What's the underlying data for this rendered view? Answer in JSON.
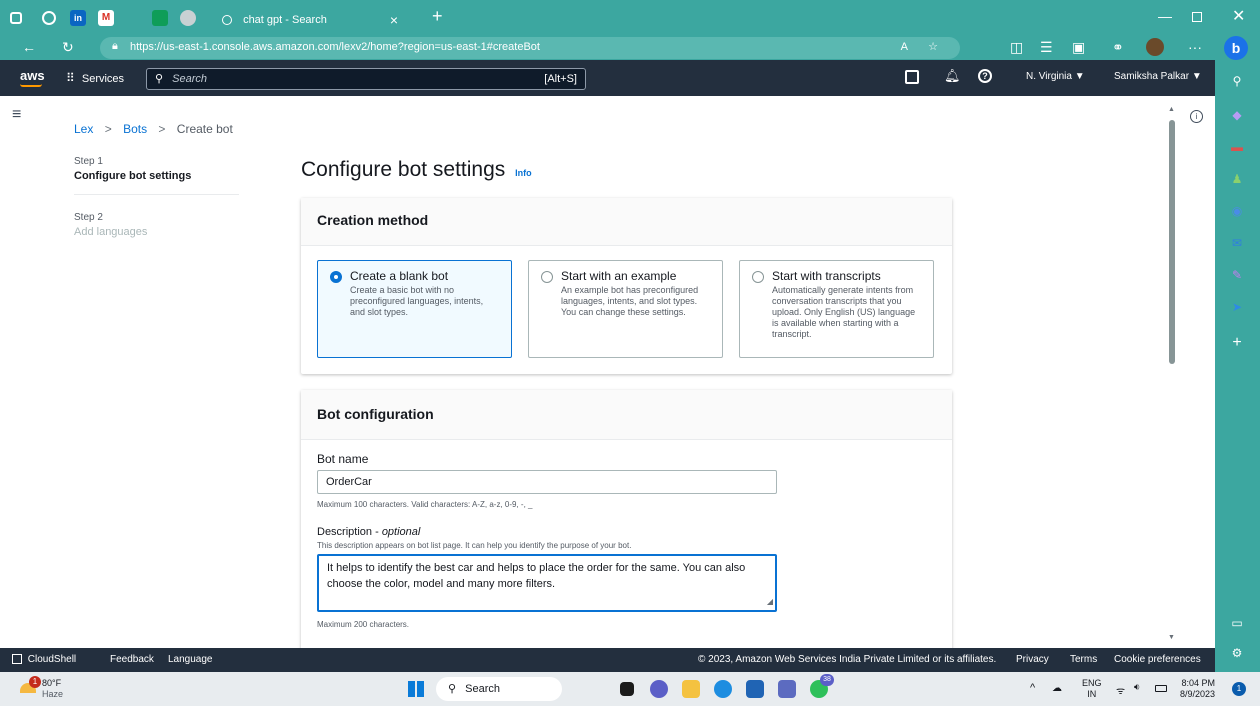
{
  "browser": {
    "tab_title": "chat gpt - Search",
    "url": "https://us-east-1.console.aws.amazon.com/lexv2/home?region=us-east-1#createBot"
  },
  "aws_header": {
    "logo": "aws",
    "services": "Services",
    "search_placeholder": "Search",
    "search_shortcut": "[Alt+S]",
    "region": "N. Virginia",
    "user": "Samiksha Palkar"
  },
  "breadcrumb": [
    "Lex",
    "Bots",
    "Create bot"
  ],
  "steps": [
    {
      "step": "Step 1",
      "label": "Configure bot settings",
      "active": true
    },
    {
      "step": "Step 2",
      "label": "Add languages",
      "active": false
    }
  ],
  "page": {
    "title": "Configure bot settings",
    "info": "Info"
  },
  "creation": {
    "heading": "Creation method",
    "options": [
      {
        "title": "Create a blank bot",
        "desc": "Create a basic bot with no preconfigured languages, intents, and slot types.",
        "selected": true
      },
      {
        "title": "Start with an example",
        "desc": "An example bot has preconfigured languages, intents, and slot types. You can change these settings.",
        "selected": false
      },
      {
        "title": "Start with transcripts",
        "desc": "Automatically generate intents from conversation transcripts that you upload. Only English (US) language is available when starting with a transcript.",
        "selected": false
      }
    ]
  },
  "botconfig": {
    "heading": "Bot configuration",
    "name_label": "Bot name",
    "name_value": "OrderCar",
    "name_hint": "Maximum 100 characters. Valid characters: A-Z, a-z, 0-9, -, _",
    "desc_label": "Description",
    "desc_optional": "optional",
    "desc_sub": "This description appears on bot list page. It can help you identify the purpose of your bot.",
    "desc_value": "It helps to identify the best car and helps to place the order for the same. You can also choose the color, model and many more filters.",
    "desc_hint": "Maximum 200 characters."
  },
  "footer": {
    "cloudshell": "CloudShell",
    "feedback": "Feedback",
    "language": "Language",
    "copyright": "© 2023, Amazon Web Services India Private Limited or its affiliates.",
    "privacy": "Privacy",
    "terms": "Terms",
    "cookies": "Cookie preferences"
  },
  "taskbar": {
    "weather_temp": "80°F",
    "weather_desc": "Haze",
    "weather_badge": "1",
    "search": "Search",
    "lang": "ENG",
    "lang_region": "IN",
    "time": "8:04 PM",
    "date": "8/9/2023",
    "whatsapp_badge": "38",
    "notif_badge": "1"
  }
}
